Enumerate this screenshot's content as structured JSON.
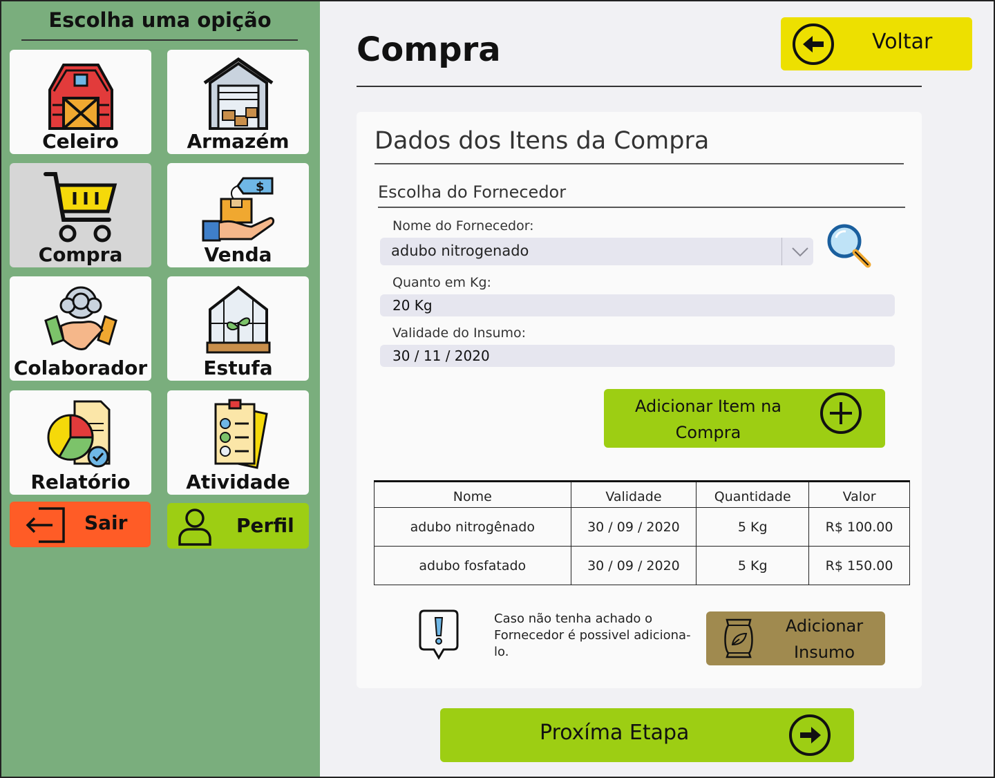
{
  "sidebar": {
    "title": "Escolha uma opição",
    "tiles": [
      {
        "label": "Celeiro",
        "icon": "barn-icon",
        "active": false
      },
      {
        "label": "Armazém",
        "icon": "warehouse-icon",
        "active": false
      },
      {
        "label": "Compra",
        "icon": "shopping-cart-icon",
        "active": true
      },
      {
        "label": "Venda",
        "icon": "sale-hand-box-icon",
        "active": false
      },
      {
        "label": "Colaborador",
        "icon": "handshake-team-icon",
        "active": false
      },
      {
        "label": "Estufa",
        "icon": "greenhouse-icon",
        "active": false
      },
      {
        "label": "Relatório",
        "icon": "report-chart-icon",
        "active": false
      },
      {
        "label": "Atividade",
        "icon": "checklist-icon",
        "active": false
      }
    ],
    "logout_label": "Sair",
    "profile_label": "Perfil"
  },
  "header": {
    "title": "Compra",
    "back_label": "Voltar"
  },
  "card": {
    "title": "Dados dos Itens da  Compra",
    "section_title": "Escolha do Fornecedor",
    "supplier_label": "Nome do Fornecedor:",
    "supplier_value": "adubo nitrogenado",
    "quantity_label": "Quanto em Kg:",
    "quantity_value": "20 Kg",
    "validity_label": "Validade do Insumo:",
    "validity_value": "30 / 11 / 2020",
    "add_item_label": "Adicionar Item na Compra",
    "table": {
      "headers": [
        "Nome",
        "Validade",
        "Quantidade",
        "Valor"
      ],
      "rows": [
        [
          "adubo nitrogênado",
          "30 / 09 / 2020",
          "5 Kg",
          "R$ 100.00"
        ],
        [
          "adubo fosfatado",
          "30 / 09 / 2020",
          "5 Kg",
          "R$ 150.00"
        ]
      ]
    },
    "alert_text": "Caso não tenha achado o Fornecedor é possivel adiciona-lo.",
    "add_insumo_label": "Adicionar Insumo"
  },
  "footer": {
    "next_label": "Proxíma Etapa"
  },
  "colors": {
    "sidebar_bg": "#7aae7d",
    "accent_yellow": "#ede000",
    "accent_green": "#9dce13",
    "logout_orange": "#ff5c26",
    "insumo_brown": "#a08a4f",
    "active_tile": "#d6d6d6"
  }
}
